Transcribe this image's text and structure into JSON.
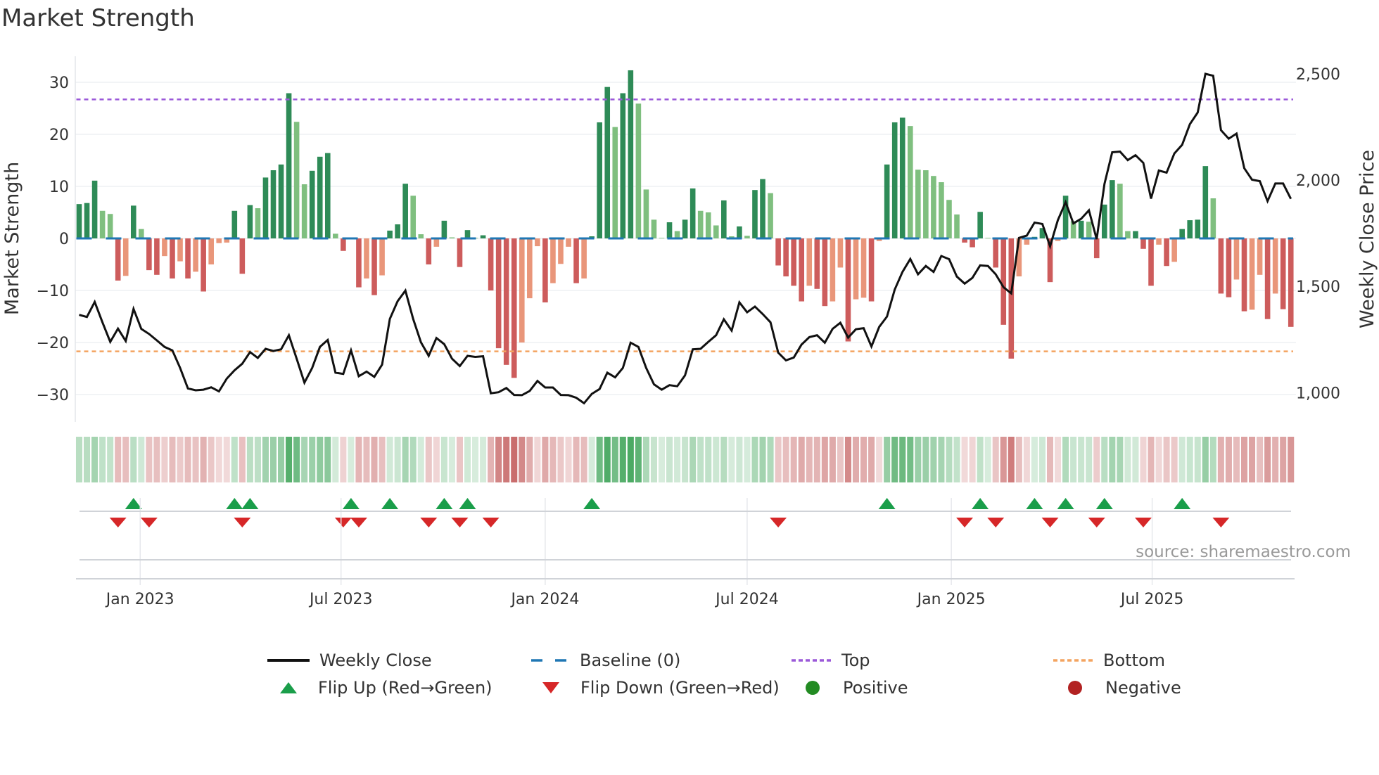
{
  "title": "Market Strength",
  "source": "source: sharemaestro.com",
  "chart_data": {
    "type": "bar",
    "title": "Market Strength",
    "ylabel": "Market Strength",
    "y2label": "Weekly Close Price",
    "ylim": [
      -33,
      36
    ],
    "y2lim": [
      900,
      2600
    ],
    "yticks": [
      "30",
      "20",
      "10",
      "0",
      "−10",
      "−20",
      "−30"
    ],
    "ytick_values": [
      30,
      20,
      10,
      0,
      -10,
      -20,
      -30
    ],
    "y2ticks": [
      "2,500",
      "2,000",
      "1,500",
      "1,000"
    ],
    "y2tick_values": [
      2500,
      2000,
      1500,
      1000
    ],
    "first_week": "2022-11-07",
    "xticks": [
      {
        "label": "Jan 2023",
        "date": "2023-01-01"
      },
      {
        "label": "Jul 2023",
        "date": "2023-07-01"
      },
      {
        "label": "Jan 2024",
        "date": "2024-01-01"
      },
      {
        "label": "Jul 2024",
        "date": "2024-07-01"
      },
      {
        "label": "Jan 2025",
        "date": "2025-01-01"
      },
      {
        "label": "Jul 2025",
        "date": "2025-07-01"
      }
    ],
    "top_level": 26.7,
    "bottom_level": -21.7,
    "strength": [
      6.6,
      6.8,
      11.1,
      5.3,
      4.7,
      -8.1,
      -7.2,
      6.3,
      1.8,
      -6.1,
      -7.0,
      -3.4,
      -7.7,
      -4.4,
      -7.7,
      -6.4,
      -10.2,
      -5.0,
      -0.9,
      -0.8,
      5.3,
      -6.8,
      6.4,
      5.8,
      11.7,
      13.1,
      14.2,
      27.9,
      22.4,
      10.4,
      13.0,
      15.7,
      16.4,
      0.9,
      -2.4,
      0.2,
      -9.4,
      -7.7,
      -10.9,
      -7.1,
      1.5,
      2.7,
      10.5,
      8.2,
      0.8,
      -5.0,
      -1.6,
      3.4,
      0.2,
      -5.5,
      1.6,
      0.1,
      0.6,
      -10.0,
      -21.1,
      -24.3,
      -26.8,
      -20.0,
      -11.5,
      -1.5,
      -12.3,
      -8.6,
      -4.9,
      -1.6,
      -8.6,
      -7.7,
      0.4,
      22.3,
      29.1,
      21.4,
      27.9,
      32.3,
      25.9,
      9.4,
      3.6,
      0.1,
      3.1,
      1.4,
      3.6,
      9.6,
      5.3,
      5.0,
      2.5,
      7.3,
      0.4,
      2.3,
      0.5,
      9.3,
      11.4,
      8.7,
      -5.2,
      -7.3,
      -9.1,
      -12.1,
      -9.1,
      -9.7,
      -13.0,
      -12.1,
      -5.6,
      -19.8,
      -11.7,
      -11.4,
      -12.1,
      -0.5,
      14.2,
      22.3,
      23.2,
      21.6,
      13.2,
      13.1,
      12.0,
      10.8,
      7.4,
      4.6,
      -0.8,
      -1.7,
      5.1,
      0.1,
      -5.6,
      -16.6,
      -23.1,
      -7.3,
      -1.2,
      0.3,
      2.0,
      -8.4,
      -0.5,
      8.2,
      3.3,
      3.4,
      3.2,
      -3.8,
      6.5,
      11.2,
      10.5,
      1.4,
      1.4,
      -2.0,
      -9.1,
      -1.2,
      -5.3,
      -4.5,
      1.8,
      3.5,
      3.6,
      13.9,
      7.7,
      -10.6,
      -11.3,
      -7.9,
      -14.0,
      -13.7,
      -7.0,
      -15.5,
      -10.6,
      -13.6,
      -17.0
    ],
    "weekly_close": [
      1366,
      1356,
      1427,
      1331,
      1239,
      1301,
      1243,
      1394,
      1300,
      1276,
      1246,
      1215,
      1199,
      1116,
      1020,
      1011,
      1014,
      1025,
      1006,
      1066,
      1105,
      1136,
      1191,
      1163,
      1206,
      1196,
      1204,
      1270,
      1160,
      1047,
      1116,
      1215,
      1248,
      1094,
      1088,
      1199,
      1077,
      1099,
      1074,
      1132,
      1347,
      1430,
      1480,
      1347,
      1237,
      1173,
      1257,
      1228,
      1160,
      1125,
      1173,
      1168,
      1171,
      997,
      1002,
      1022,
      989,
      988,
      1008,
      1055,
      1024,
      1024,
      989,
      988,
      976,
      950,
      994,
      1017,
      1094,
      1072,
      1116,
      1235,
      1215,
      1116,
      1039,
      1014,
      1035,
      1030,
      1081,
      1204,
      1206,
      1239,
      1270,
      1345,
      1292,
      1425,
      1378,
      1405,
      1370,
      1331,
      1188,
      1152,
      1165,
      1226,
      1261,
      1270,
      1235,
      1300,
      1329,
      1259,
      1298,
      1303,
      1217,
      1309,
      1358,
      1485,
      1568,
      1629,
      1557,
      1596,
      1568,
      1643,
      1628,
      1546,
      1513,
      1540,
      1599,
      1596,
      1557,
      1496,
      1467,
      1728,
      1739,
      1800,
      1794,
      1689,
      1811,
      1896,
      1796,
      1818,
      1858,
      1722,
      1982,
      2131,
      2134,
      2094,
      2117,
      2081,
      1913,
      2045,
      2035,
      2125,
      2166,
      2263,
      2318,
      2500,
      2491,
      2235,
      2195,
      2219,
      2056,
      2002,
      1995,
      1901,
      1984,
      1984,
      1912
    ],
    "colors": {
      "strong_positive": "#2e8b57",
      "weak_positive": "#7fbf7f",
      "strong_negative": "#cd5c5c",
      "weak_negative": "#e9967a",
      "baseline": "#1f77b4",
      "top": "#9b59d9",
      "bottom": "#f4a460",
      "flip_up": "#1a9e4a",
      "flip_down": "#d62728",
      "positive": "#228b22",
      "negative": "#b22222",
      "close": "#111111"
    },
    "legend": {
      "close": "Weekly Close",
      "baseline": "Baseline (0)",
      "top": "Top",
      "bottom": "Bottom",
      "flip_up": "Flip Up (Red→Green)",
      "flip_down": "Flip Down (Green→Red)",
      "positive": "Positive",
      "negative": "Negative"
    }
  }
}
